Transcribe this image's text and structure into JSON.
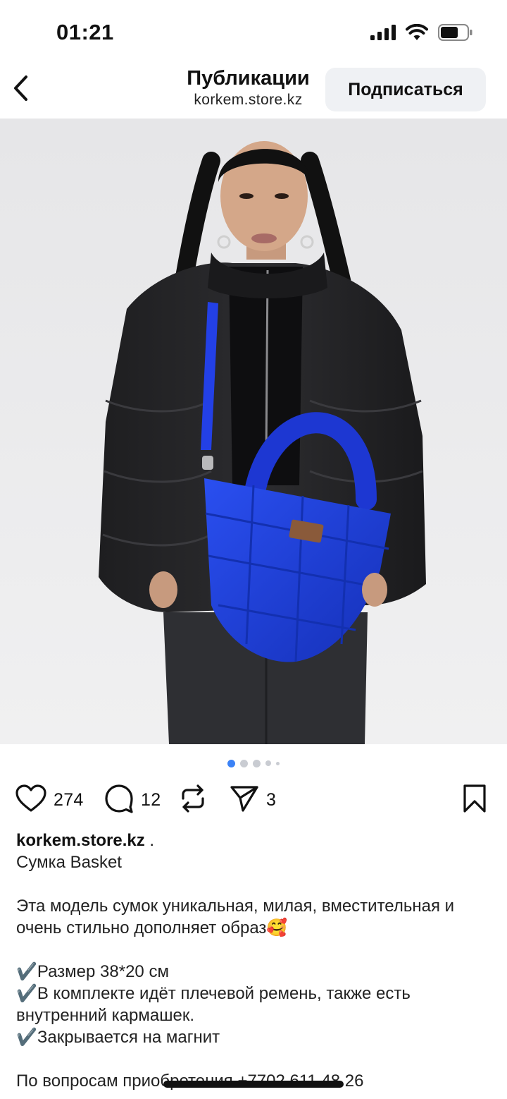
{
  "status_bar": {
    "time": "01:21"
  },
  "header": {
    "title": "Публикации",
    "subtitle": "korkem.store.kz",
    "follow_label": "Подписаться"
  },
  "carousel": {
    "total": 5,
    "active_index": 0
  },
  "actions": {
    "likes": "274",
    "comments": "12",
    "shares": "3"
  },
  "caption": {
    "username": "korkem.store.kz",
    "username_suffix": " .",
    "title": "Сумка Basket",
    "description": "Эта модель сумок уникальная, милая, вместительная и очень стильно дополняет образ🥰",
    "features": [
      "✔️Размер 38*20 см",
      "✔️В комплекте идёт плечевой ремень, также есть внутренний кармашек.",
      "✔️Закрывается на магнит"
    ],
    "contact": "По вопросам приобретения +7702 611 48 26"
  },
  "colors": {
    "accent_dot": "#3b82f6",
    "bag_blue": "#1f3fd6",
    "follow_bg": "#eff1f4"
  },
  "icons": {
    "back": "chevron-left-icon",
    "like": "heart-icon",
    "comment": "comment-bubble-icon",
    "repost": "repost-icon",
    "share": "send-icon",
    "save": "bookmark-icon"
  }
}
